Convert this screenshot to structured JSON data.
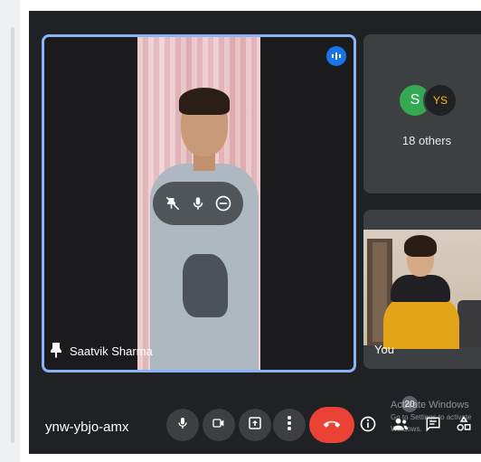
{
  "meeting": {
    "code": "ynw-ybjo-amx",
    "participant_count": "20"
  },
  "main_tile": {
    "participant_name": "Saatvik Sharma",
    "icons": [
      "pin-icon",
      "speaking-indicator-icon"
    ],
    "overlay_controls": [
      "unpin-icon",
      "mute-participant-icon",
      "remove-icon"
    ]
  },
  "others_tile": {
    "avatars": [
      {
        "initials": "S",
        "color": "#34a853"
      },
      {
        "initials": "YS",
        "color": "#202124"
      }
    ],
    "label": "18 others"
  },
  "self_tile": {
    "label": "You"
  },
  "controls": [
    "mic-icon",
    "camera-icon",
    "present-icon",
    "more-options-icon",
    "end-call-icon",
    "info-icon",
    "people-icon",
    "chat-icon",
    "activities-icon"
  ],
  "watermark": {
    "line1": "Activate Windows",
    "line2": "Go to Settings to activate Windows."
  },
  "colors": {
    "background": "#202124",
    "tile": "#3c4043",
    "active_border": "#8ab4f8",
    "hangup": "#ea4335",
    "speaking": "#1a73e8"
  }
}
